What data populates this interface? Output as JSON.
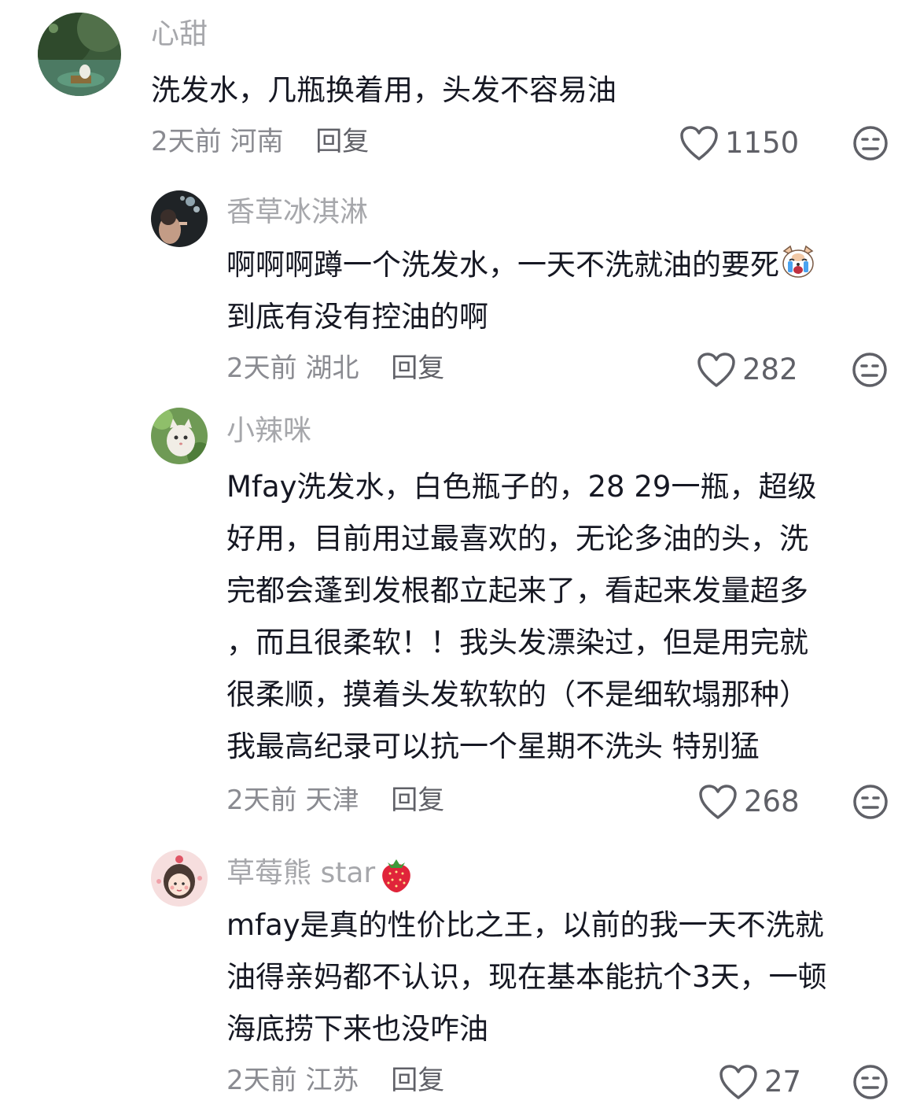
{
  "comments": [
    {
      "username": "心甜",
      "lines": [
        "洗发水，几瓶换着用，头发不容易油"
      ],
      "time": "2天前",
      "location": "河南",
      "reply_label": "回复",
      "likes": "1150"
    },
    {
      "username": "香草冰淇淋",
      "lines": [
        "啊啊啊蹲一个洗发水，一天不洗就油的要死",
        "到底有没有控油的啊"
      ],
      "time": "2天前",
      "location": "湖北",
      "reply_label": "回复",
      "likes": "282"
    },
    {
      "username": "小辣咪",
      "lines": [
        "Mfay洗发水，白色瓶子的，28 29一瓶，超级",
        "好用，目前用过最喜欢的，无论多油的头，洗",
        "完都会蓬到发根都立起来了，看起来发量超多",
        "，而且很柔软！！我头发漂染过，但是用完就",
        "很柔顺，摸着头发软软的（不是细软塌那种）",
        "我最高纪录可以抗一个星期不洗头 特别猛"
      ],
      "time": "2天前",
      "location": "天津",
      "reply_label": "回复",
      "likes": "268"
    },
    {
      "username": "草莓熊 star",
      "lines": [
        "mfay是真的性价比之王，以前的我一天不洗就",
        "油得亲妈都不认识，现在基本能抗个3天，一顿",
        "海底捞下来也没咋油"
      ],
      "time": "2天前",
      "location": "江苏",
      "reply_label": "回复",
      "likes": "27"
    }
  ],
  "icons": {
    "like": "heart-outline-icon",
    "dislike": "meh-face-icon",
    "crying-dog-emoji": "crying-dog-emoji",
    "strawberry-emoji": "strawberry-emoji"
  },
  "colors": {
    "text": "#161823",
    "username": "#a6a7ab",
    "meta": "#8a8b91",
    "icon": "#5f6067"
  }
}
